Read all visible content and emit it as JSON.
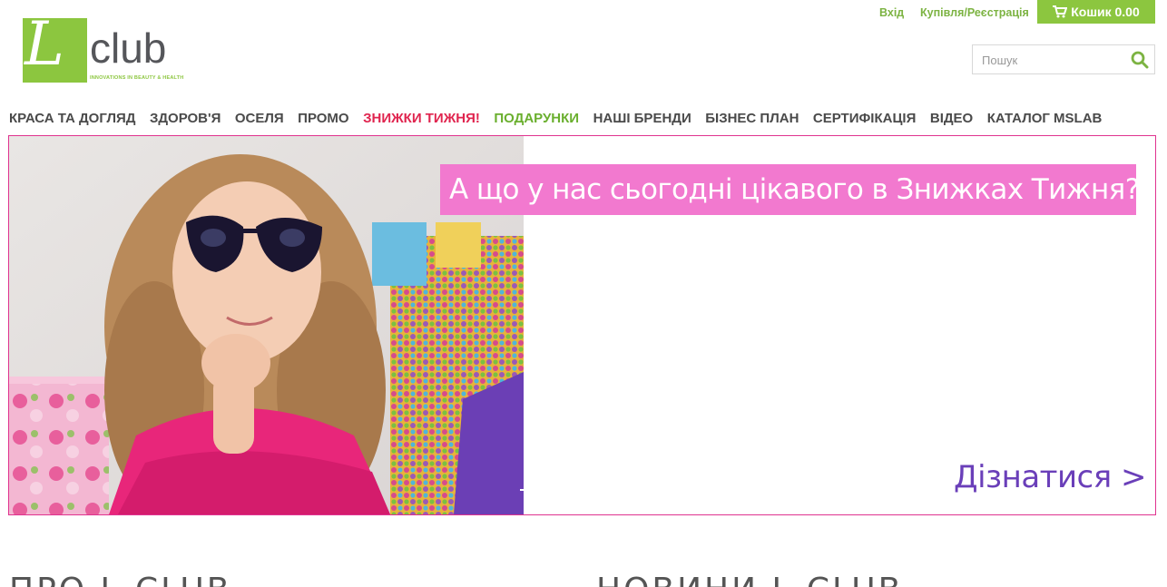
{
  "logo": {
    "letter": "L",
    "word": "club",
    "tagline": "INNOVATIONS IN BEAUTY & HEALTH",
    "brand_color": "#8cc63f"
  },
  "header": {
    "login_label": "Вхід",
    "register_label": "Купівля/Реєстрація",
    "cart_label": "Кошик 0.00",
    "cart_icon": "cart-icon"
  },
  "search": {
    "placeholder": "Пошук",
    "value": "",
    "icon": "search-icon"
  },
  "nav": {
    "items": [
      {
        "label": "КРАСА ТА ДОГЛЯД"
      },
      {
        "label": "ЗДОРОВ'Я"
      },
      {
        "label": "ОСЕЛЯ"
      },
      {
        "label": "ПРОМО"
      },
      {
        "label": "ЗНИЖКИ ТИЖНЯ!",
        "color": "#e0254f"
      },
      {
        "label": "ПОДАРУНКИ",
        "color": "#6aaf2e"
      },
      {
        "label": "НАШІ БРЕНДИ"
      },
      {
        "label": "БІЗНЕС ПЛАН"
      },
      {
        "label": "СЕРТИФІКАЦІЯ"
      },
      {
        "label": "ВІДЕО"
      },
      {
        "label": "КАТАЛОГ MSLAB"
      }
    ]
  },
  "banner": {
    "headline": "А що у нас сьогодні цікавого в Знижках Тижня?",
    "cta": "Дізнатися >",
    "border_color": "#e0338f",
    "headline_bg": "#f279cf",
    "cta_color": "#6a3fb9"
  },
  "sections": {
    "left_title": "ПРО L-CLUB",
    "right_title": "НОВИНИ L-CLUB"
  }
}
